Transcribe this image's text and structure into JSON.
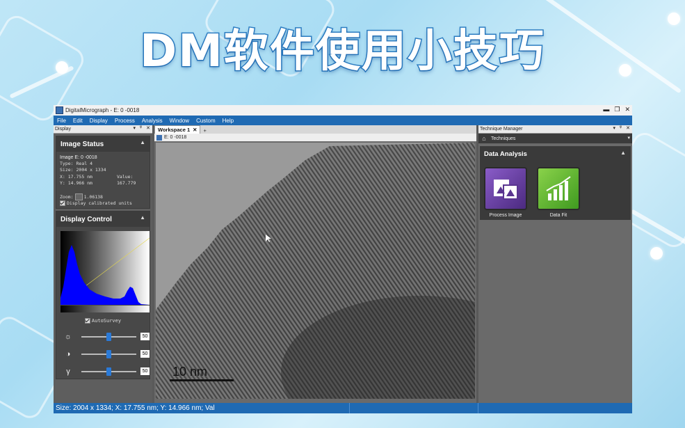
{
  "banner": {
    "title": "DM软件使用小技巧"
  },
  "window": {
    "title": "DigitalMicrograph - E: 0 -0018",
    "controls": [
      "▬",
      "❐",
      "✕"
    ]
  },
  "menu": [
    "File",
    "Edit",
    "Display",
    "Process",
    "Analysis",
    "Window",
    "Custom",
    "Help"
  ],
  "left_panel": {
    "header": "Display",
    "controls": [
      "▾",
      "ᵠ",
      "✕"
    ],
    "image_status": {
      "title": "Image Status",
      "image_name": "Image E: 0 -0018",
      "type_label": "Type:",
      "type_value": "Real 4",
      "size_label": "Size:",
      "size_value": "2004 x 1334",
      "x_label": "X:",
      "x_value": "17.755 nm",
      "value_label": "Value:",
      "y_label": "Y:",
      "y_value": "14.966 nm",
      "value_value": "167.779",
      "zoom_label": "Zoom:",
      "zoom_value": "1.06138",
      "calibrated_label": "Display calibrated units"
    },
    "display_control": {
      "title": "Display Control",
      "autosurvey_label": "AutoSurvey",
      "sliders": [
        {
          "icon": "brightness-icon",
          "glyph": "☼",
          "value": "50"
        },
        {
          "icon": "contrast-icon",
          "glyph": "◑",
          "value": "50"
        },
        {
          "icon": "gamma-icon",
          "glyph": "γ",
          "value": "50"
        }
      ]
    }
  },
  "workspace": {
    "tab_label": "Workspace 1",
    "tab_close": "✕",
    "tab_add": "+",
    "image_title": "E: 0 -0018",
    "scale_label": "10 nm"
  },
  "right_panel": {
    "header": "Technique Manager",
    "controls": [
      "▾",
      "ᵠ",
      "✕"
    ],
    "techniques_label": "Techniques",
    "dropdown_glyph": "▾",
    "data_analysis": {
      "title": "Data Analysis",
      "tools": [
        {
          "label": "Process Image",
          "icon": "process-image-icon",
          "color": "#6a3fa6"
        },
        {
          "label": "Data Fit",
          "icon": "data-fit-icon",
          "color": "#5fb030"
        }
      ]
    }
  },
  "status_bar": {
    "text": "Size: 2004 x 1334;  X:  17.755 nm;  Y:  14.966 nm;  Val"
  },
  "colors": {
    "menu_blue": "#1f6ab3",
    "histogram": "#0000ff",
    "card_bg": "#3a3a3a"
  }
}
